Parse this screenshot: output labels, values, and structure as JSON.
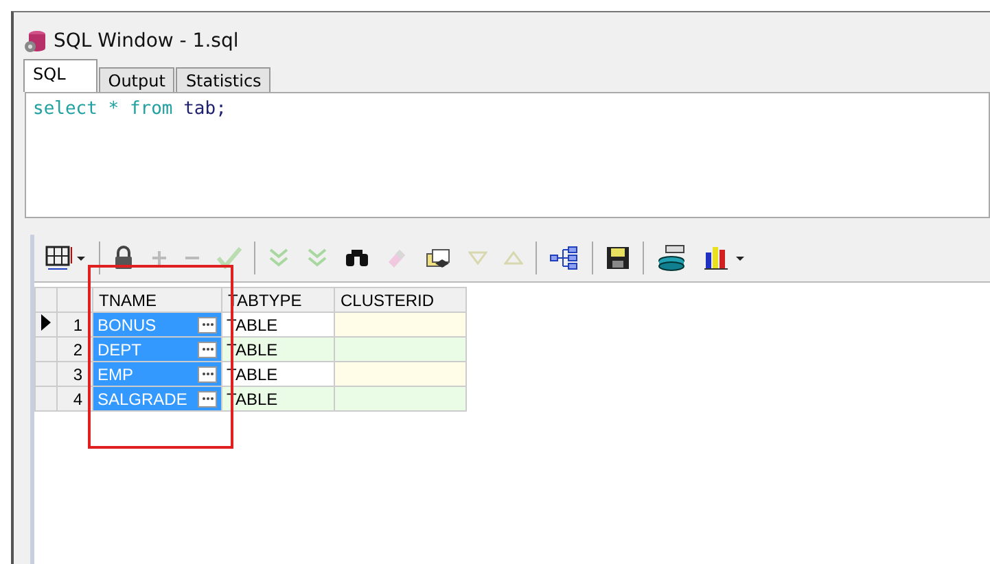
{
  "window": {
    "title": "SQL Window - 1.sql"
  },
  "tabs": [
    {
      "label": "SQL",
      "selected": true
    },
    {
      "label": "Output",
      "selected": false
    },
    {
      "label": "Statistics",
      "selected": false
    }
  ],
  "editor": {
    "keyword1": "select",
    "star": "*",
    "keyword2": "from",
    "rest": "tab;"
  },
  "toolbar": [
    {
      "kind": "grid"
    },
    {
      "kind": "lock"
    },
    {
      "kind": "plus"
    },
    {
      "kind": "minus"
    },
    {
      "kind": "check"
    },
    {
      "kind": "down2"
    },
    {
      "kind": "down2b"
    },
    {
      "kind": "find"
    },
    {
      "kind": "eraser"
    },
    {
      "kind": "export"
    },
    {
      "kind": "down"
    },
    {
      "kind": "up"
    },
    {
      "kind": "tree"
    },
    {
      "kind": "save"
    },
    {
      "kind": "db"
    },
    {
      "kind": "chart"
    }
  ],
  "table": {
    "columns": [
      "TNAME",
      "TABTYPE",
      "CLUSTERID"
    ],
    "rows": [
      {
        "num": "1",
        "current": true,
        "selected": true,
        "tname": "BONUS",
        "tabtype": "TABLE"
      },
      {
        "num": "2",
        "current": false,
        "selected": true,
        "tname": "DEPT",
        "tabtype": "TABLE"
      },
      {
        "num": "3",
        "current": false,
        "selected": true,
        "tname": "EMP",
        "tabtype": "TABLE"
      },
      {
        "num": "4",
        "current": false,
        "selected": true,
        "tname": "SALGRADE",
        "tabtype": "TABLE"
      }
    ]
  }
}
